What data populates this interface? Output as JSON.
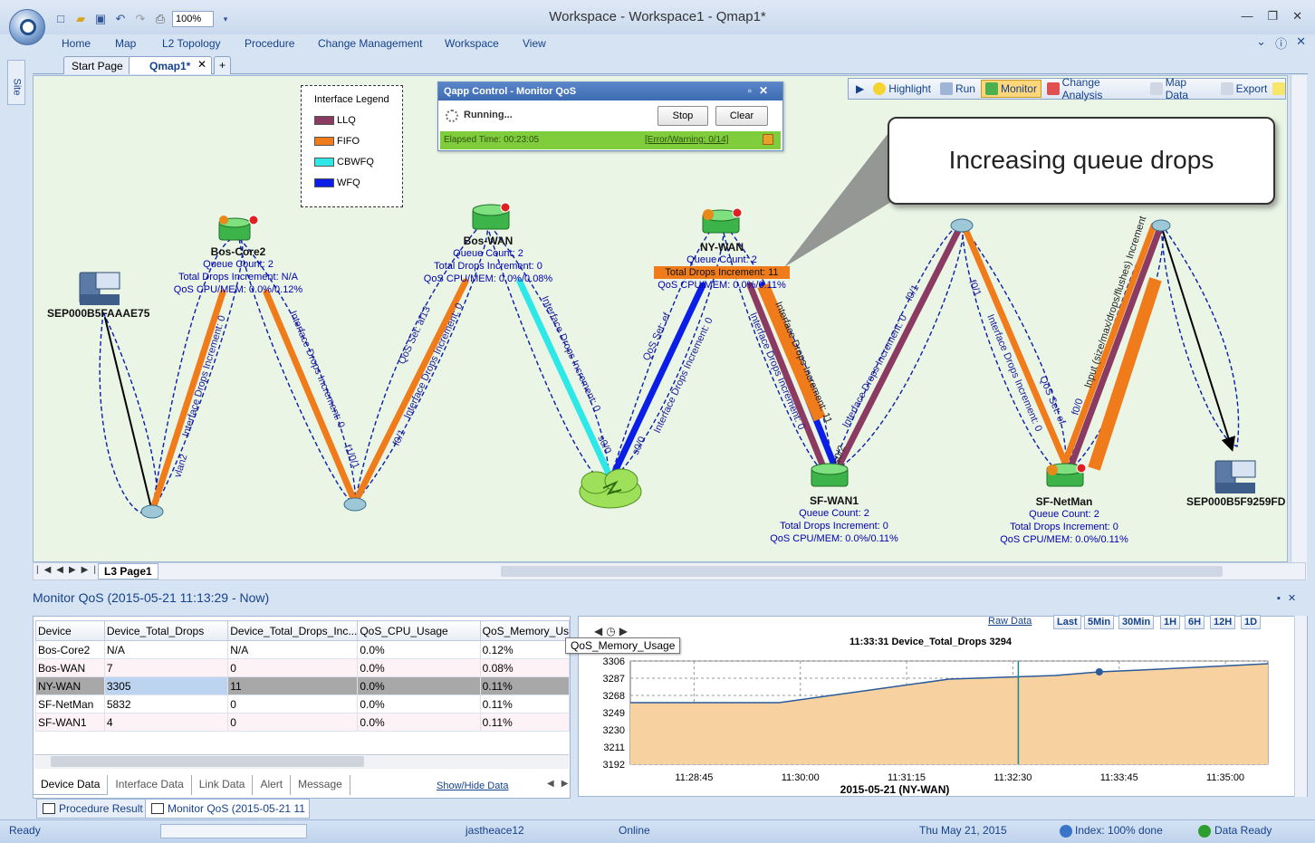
{
  "window": {
    "title": "Workspace - Workspace1 - Qmap1*",
    "zoom": "100%"
  },
  "ribbon_tabs": [
    "Home",
    "Map",
    "L2 Topology",
    "Procedure",
    "Change Management",
    "Workspace",
    "View"
  ],
  "doc_tabs": {
    "start": "Start Page",
    "active": "Qmap1*",
    "add": "+"
  },
  "side": {
    "site": "Site"
  },
  "legend": {
    "title": "Interface Legend",
    "items": [
      {
        "label": "LLQ",
        "color": "#8b3a62"
      },
      {
        "label": "FIFO",
        "color": "#f07b1a"
      },
      {
        "label": "CBWFQ",
        "color": "#2ee8e8"
      },
      {
        "label": "WFQ",
        "color": "#0a1ee8"
      }
    ]
  },
  "qapp": {
    "title": "Qapp Control - Monitor QoS",
    "status": "Running...",
    "stop": "Stop",
    "clear": "Clear",
    "elapsed": "Elapsed Time: 00:23:05",
    "errors": "[Error/Warning: 0/14]"
  },
  "map_toolbar": [
    "Highlight",
    "Run",
    "Monitor",
    "Change Analysis",
    "Map Data",
    "Export"
  ],
  "callout": "Increasing queue drops",
  "devices": {
    "bos_core2": {
      "name": "Bos-Core2",
      "q": "Queue Count: 2",
      "drops": "Total Drops Increment: N/A",
      "cpu": "QoS CPU/MEM: 0.0%/0.12%"
    },
    "bos_wan": {
      "name": "Bos-WAN",
      "q": "Queue Count: 2",
      "drops": "Total Drops Increment: 0",
      "cpu": "QoS CPU/MEM: 0.0%/0.08%"
    },
    "ny_wan": {
      "name": "NY-WAN",
      "q": "Queue Count: 2",
      "drops": "Total Drops Increment: 11",
      "cpu": "QoS CPU/MEM: 0.0%/0.11%"
    },
    "sf_wan1": {
      "name": "SF-WAN1",
      "q": "Queue Count: 2",
      "drops": "Total Drops Increment: 0",
      "cpu": "QoS CPU/MEM: 0.0%/0.11%"
    },
    "sf_netman": {
      "name": "SF-NetMan",
      "q": "Queue Count: 2",
      "drops": "Total Drops Increment: 0",
      "cpu": "QoS CPU/MEM: 0.0%/0.11%"
    },
    "phone1": {
      "name": "SEP000B5FAAAE75"
    },
    "phone2": {
      "name": "SEP000B5F9259FD"
    }
  },
  "link_labels": {
    "l1": "Interface Drops Increment: 0",
    "vlan2": "vlan2",
    "l2": "Interface Drops Increment: 0",
    "f1_0_1": "f1/0/1",
    "l3": "Interface Drops Increment: 0",
    "qos_af13": "QoS Set: af13",
    "f0_1a": "f0/1",
    "l4": "Interface Drops Increment: 0",
    "s0_0a": "s0/0",
    "qos_ef1": "QoS Set: ef",
    "l5": "Interface Drops Increment: 0",
    "s0_0b": "s0/0",
    "l6": "Interface Drops Increment: 0",
    "l7": "Interface Drops Increment: 11",
    "s0_2": "s0/2",
    "l8": "Interface Drops Increment: 0",
    "f0_1b": "f0/1",
    "f0_1c": "f0/1",
    "l9": "Interface Drops Increment: 0",
    "qos_ef2": "QoS Set: ef",
    "f0_0": "f0/0",
    "input": "Input (size/max/drops/flushes) Increment"
  },
  "page_tab": "L3 Page1",
  "monitor": {
    "title": "Monitor QoS (2015-05-21 11:13:29 - Now)",
    "columns": [
      "Device",
      "Device_Total_Drops",
      "Device_Total_Drops_Inc...",
      "QoS_CPU_Usage",
      "QoS_Memory_Us"
    ],
    "rows": [
      [
        "Bos-Core2",
        "N/A",
        "N/A",
        "0.0%",
        "0.12%"
      ],
      [
        "Bos-WAN",
        "7",
        "0",
        "0.0%",
        "0.08%"
      ],
      [
        "NY-WAN",
        "3305",
        "11",
        "0.0%",
        "0.11%"
      ],
      [
        "SF-NetMan",
        "5832",
        "0",
        "0.0%",
        "0.11%"
      ],
      [
        "SF-WAN1",
        "4",
        "0",
        "0.0%",
        "0.11%"
      ]
    ],
    "tabs": [
      "Device Data",
      "Interface Data",
      "Link Data",
      "Alert",
      "Message"
    ],
    "show_hide": "Show/Hide Data",
    "tooltip": "QoS_Memory_Usage"
  },
  "chart_controls": {
    "raw": "Raw Data",
    "ranges": [
      "Last",
      "5Min",
      "30Min",
      "1H",
      "6H",
      "12H",
      "1D"
    ]
  },
  "chart_data": {
    "type": "area",
    "title": "11:33:31 Device_Total_Drops 3294",
    "xlabel": "2015-05-21 (NY-WAN)",
    "ylabel": "",
    "x_ticks": [
      "11:28:45",
      "11:30:00",
      "11:31:15",
      "11:32:30",
      "11:33:45",
      "11:35:00"
    ],
    "y_ticks": [
      3306,
      3287,
      3268,
      3249,
      3230,
      3211,
      3192
    ],
    "ylim": [
      3192,
      3306
    ],
    "x": [
      "11:28:00",
      "11:29:45",
      "11:31:45",
      "11:33:00",
      "11:33:31",
      "11:34:00",
      "11:35:30"
    ],
    "values": [
      3260,
      3260,
      3286,
      3290,
      3294,
      3296,
      3303
    ],
    "color": "#f7d2a0",
    "line_color": "#2a5a9a"
  },
  "bottom_tabs": [
    "Procedure Result",
    "Monitor QoS (2015-05-21 11"
  ],
  "status": {
    "ready": "Ready",
    "user": "jastheace12",
    "online": "Online",
    "date": "Thu May 21, 2015",
    "index": "Index: 100% done",
    "data": "Data Ready"
  }
}
